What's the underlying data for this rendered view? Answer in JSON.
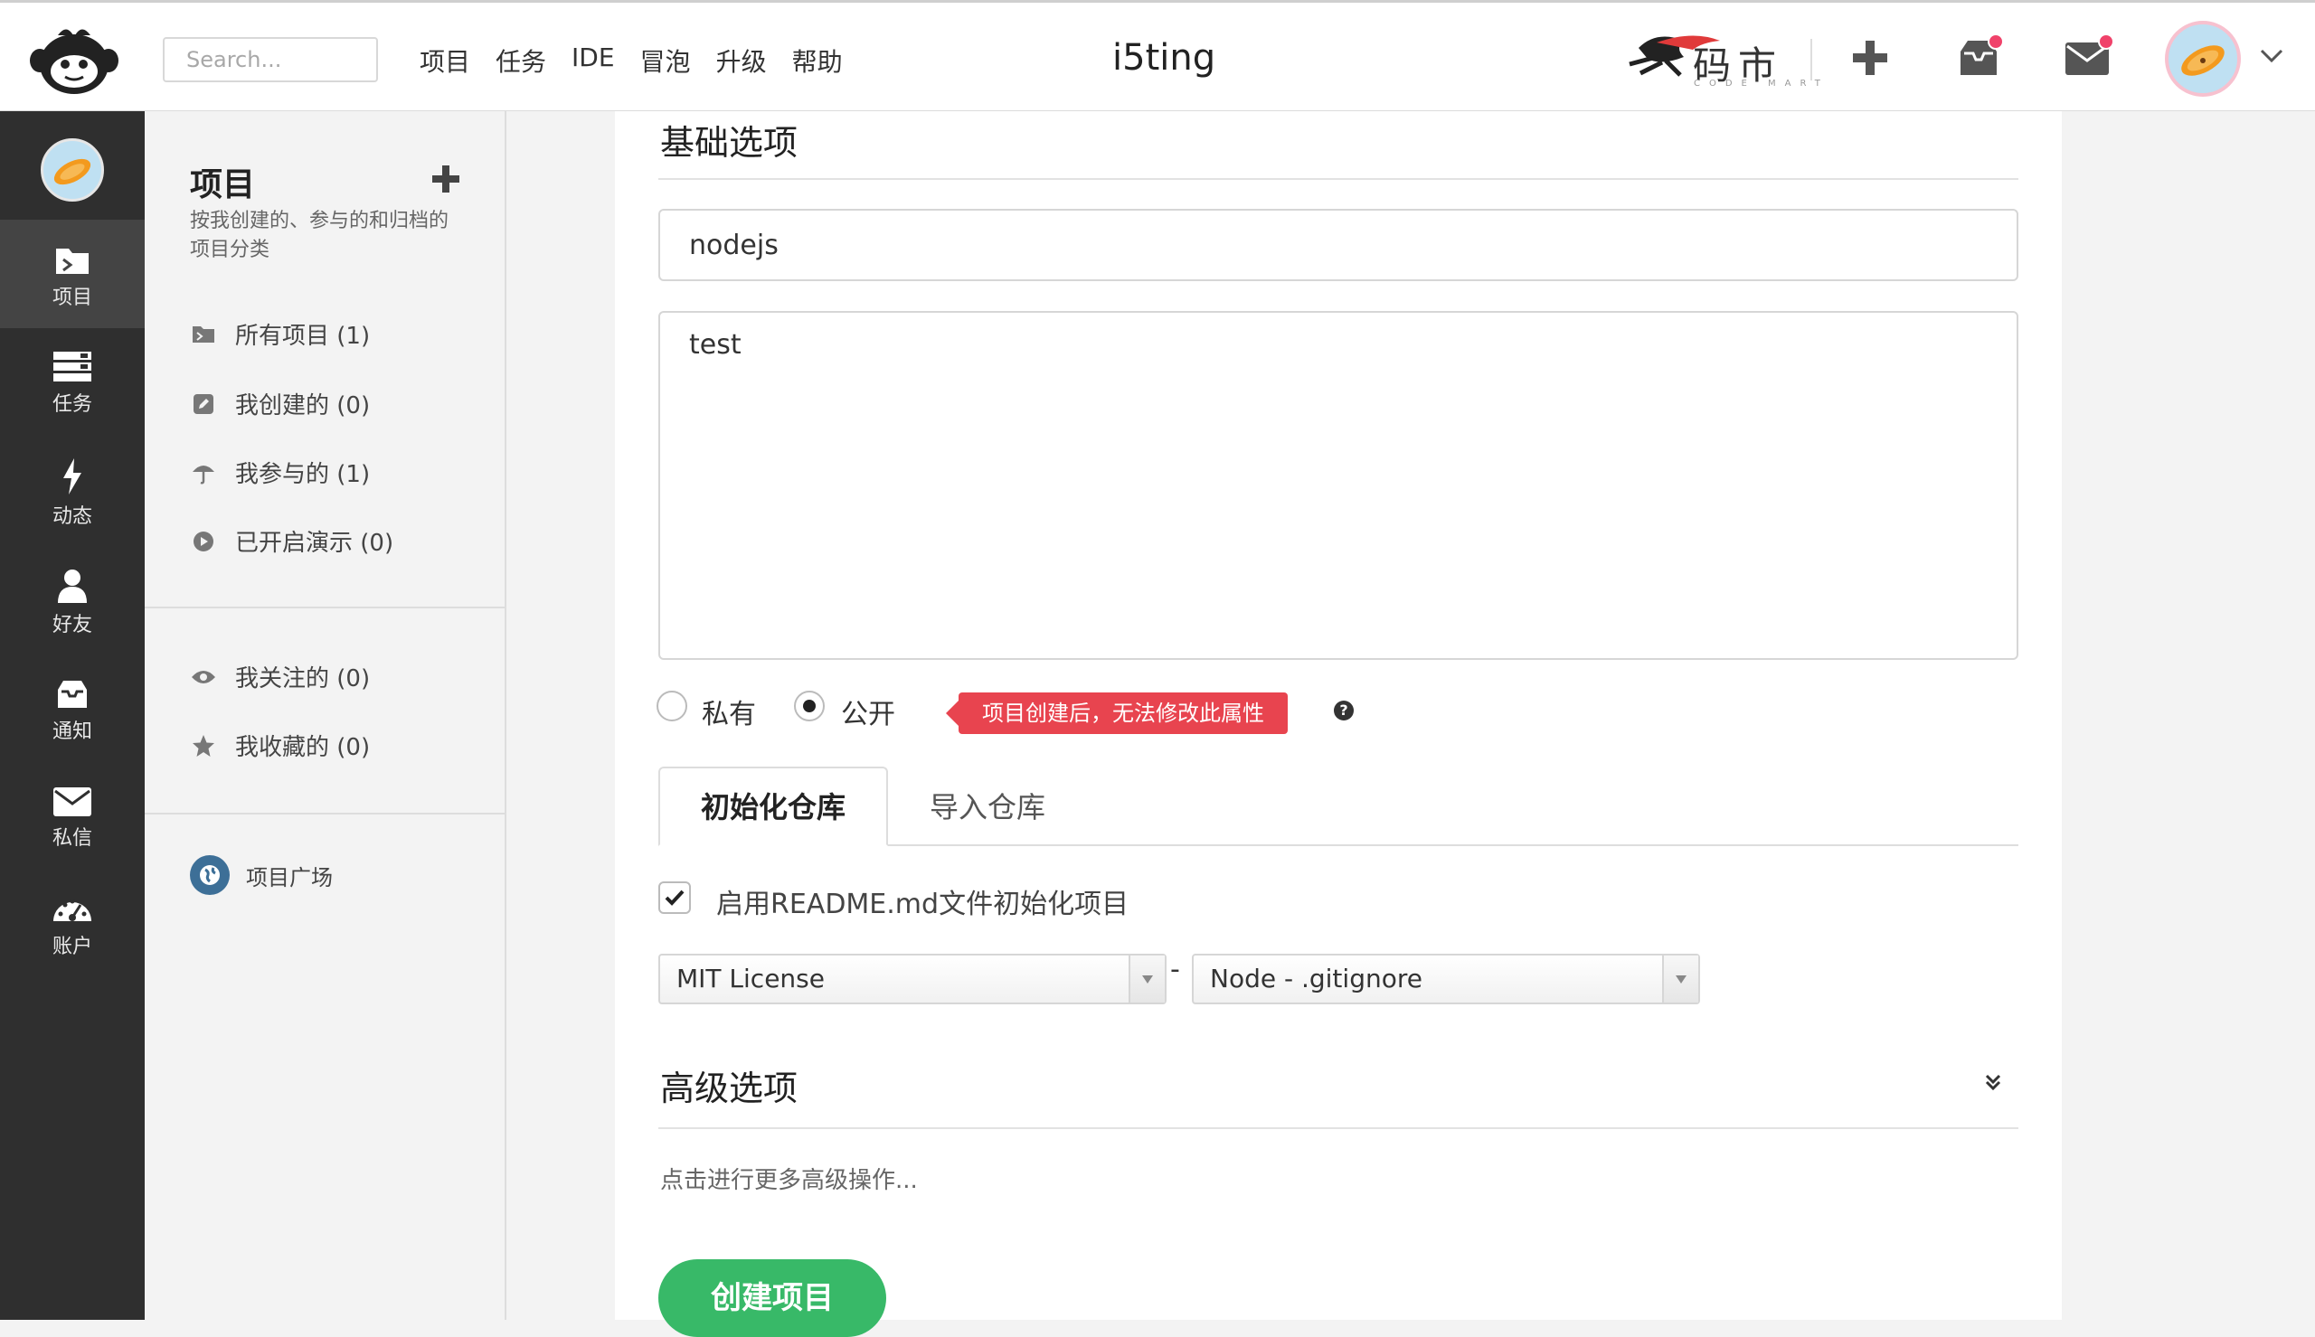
{
  "header": {
    "search_placeholder": "Search...",
    "nav": [
      "项目",
      "任务",
      "IDE",
      "冒泡",
      "升级",
      "帮助"
    ],
    "title": "i5ting",
    "mart_text": "码市",
    "mart_sub": "CODE MART"
  },
  "rail": {
    "items": [
      {
        "label": "项目",
        "icon": "folder-icon",
        "active": true
      },
      {
        "label": "任务",
        "icon": "tasks-icon"
      },
      {
        "label": "动态",
        "icon": "bolt-icon"
      },
      {
        "label": "好友",
        "icon": "user-icon"
      },
      {
        "label": "通知",
        "icon": "inbox-icon"
      },
      {
        "label": "私信",
        "icon": "envelope-icon"
      },
      {
        "label": "账户",
        "icon": "dashboard-icon"
      }
    ]
  },
  "sidebar": {
    "title": "项目",
    "description": "按我创建的、参与的和归档的项目分类",
    "group1": [
      {
        "label": "所有项目 (1)",
        "icon": "folder-open-icon"
      },
      {
        "label": "我创建的 (0)",
        "icon": "edit-icon"
      },
      {
        "label": "我参与的 (1)",
        "icon": "umbrella-icon"
      },
      {
        "label": "已开启演示 (0)",
        "icon": "play-circle-icon"
      }
    ],
    "group2": [
      {
        "label": "我关注的 (0)",
        "icon": "eye-icon"
      },
      {
        "label": "我收藏的 (0)",
        "icon": "star-icon"
      }
    ],
    "plaza": "项目广场"
  },
  "form": {
    "basic_heading": "基础选项",
    "name_value": "nodejs",
    "desc_value": "test",
    "private_label": "私有",
    "public_label": "公开",
    "visibility": "public",
    "warning": "项目创建后，无法修改此属性",
    "tabs": [
      "初始化仓库",
      "导入仓库"
    ],
    "readme_label": "启用README.md文件初始化项目",
    "readme_checked": true,
    "license_value": "MIT License",
    "separator": "-",
    "gitignore_value": "Node - .gitignore",
    "advanced_heading": "高级选项",
    "advanced_hint": "点击进行更多高级操作...",
    "create_button": "创建项目"
  },
  "colors": {
    "accent_green": "#38b968",
    "warning_red": "#e8444f",
    "notify_dot": "#f0426a",
    "rail_bg": "#2f2f2f"
  }
}
